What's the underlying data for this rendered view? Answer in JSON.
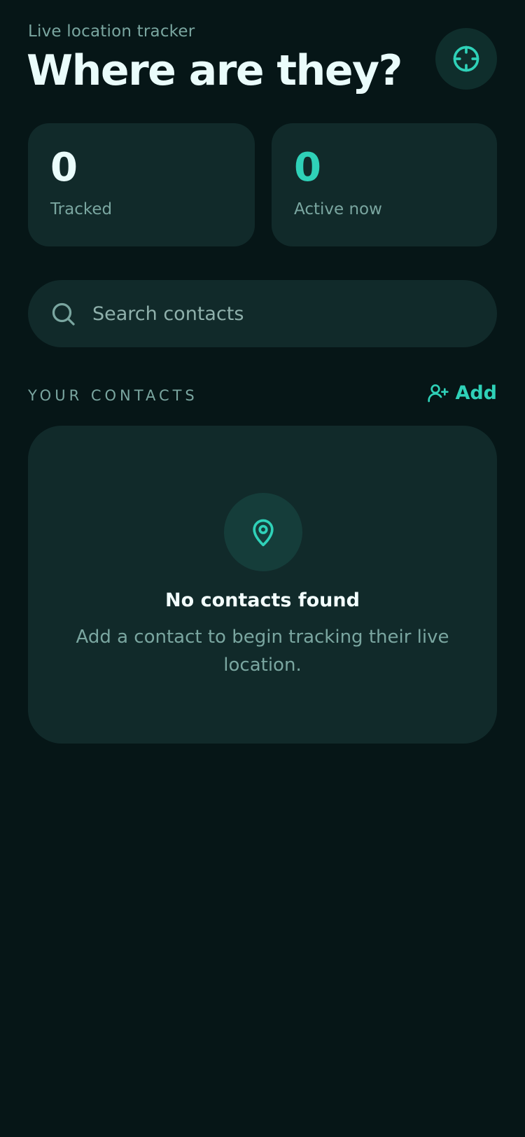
{
  "header": {
    "eyebrow": "Live location tracker",
    "title": "Where are they?",
    "locate_icon": "crosshair-icon"
  },
  "stats": [
    {
      "value": "0",
      "label": "Tracked"
    },
    {
      "value": "0",
      "label": "Active now"
    }
  ],
  "search": {
    "placeholder": "Search contacts",
    "value": "",
    "icon": "search-icon"
  },
  "contacts": {
    "section_title": "YOUR CONTACTS",
    "add_label": "Add",
    "add_icon": "user-plus-icon"
  },
  "empty_state": {
    "icon": "map-pin-icon",
    "title": "No contacts found",
    "text": "Add a contact to begin tracking their live location."
  },
  "colors": {
    "background": "#061617",
    "card": "#112a2a",
    "accent": "#2fd1b8",
    "muted_text": "#7aa6a0",
    "primary_text": "#eafcfb"
  }
}
